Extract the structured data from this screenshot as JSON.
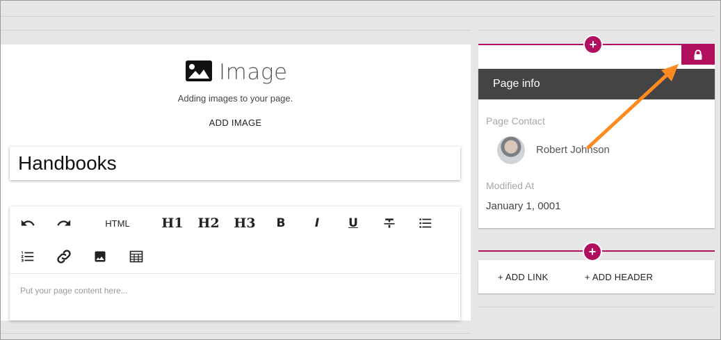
{
  "image_widget": {
    "title": "Image",
    "subtitle": "Adding images to your page.",
    "add_label": "ADD IMAGE"
  },
  "title_field": {
    "value": "Handbooks"
  },
  "editor": {
    "html_label": "HTML",
    "h1": "H1",
    "h2": "H2",
    "h3": "H3",
    "bold": "B",
    "italic": "I",
    "underline": "U",
    "placeholder": "Put your page content here..."
  },
  "page_info": {
    "header": "Page info",
    "contact_label": "Page Contact",
    "contact_name": "Robert Johnson",
    "modified_label": "Modified At",
    "modified_value": "January 1, 0001"
  },
  "links": {
    "add_link": "+ ADD LINK",
    "add_header": "+ ADD HEADER"
  },
  "plus_symbol": "+",
  "colors": {
    "accent": "#b1105e",
    "header_bg": "#444444",
    "annotation_arrow": "#ff8a1f"
  }
}
